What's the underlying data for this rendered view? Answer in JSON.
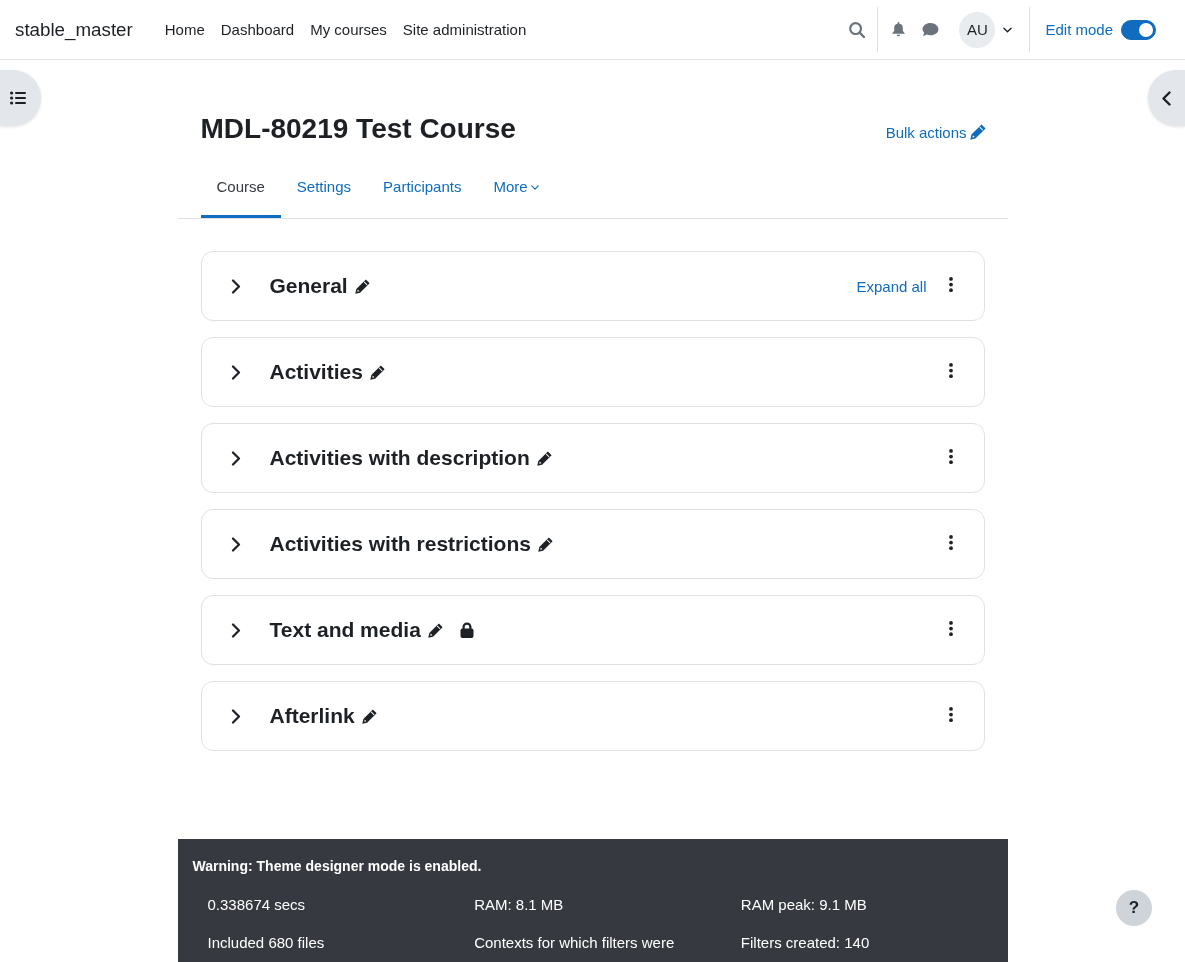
{
  "navbar": {
    "brand": "stable_master",
    "links": [
      {
        "label": "Home",
        "selected": false
      },
      {
        "label": "Dashboard",
        "selected": false
      },
      {
        "label": "My courses",
        "selected": false
      },
      {
        "label": "Site administration",
        "selected": false
      }
    ],
    "user": {
      "initials": "AU"
    },
    "edit_mode": {
      "label": "Edit mode",
      "on": true
    }
  },
  "course": {
    "title": "MDL-80219 Test Course",
    "bulk_actions": "Bulk actions"
  },
  "tabs": [
    {
      "label": "Course",
      "selected": true,
      "kind": "link"
    },
    {
      "label": "Settings",
      "selected": false,
      "kind": "link"
    },
    {
      "label": "Participants",
      "selected": false,
      "kind": "link"
    },
    {
      "label": "More",
      "selected": false,
      "kind": "menu"
    }
  ],
  "sections": [
    {
      "title": "General",
      "expanded": false,
      "locked": false,
      "expand_all": "Expand all"
    },
    {
      "title": "Activities",
      "expanded": false,
      "locked": false
    },
    {
      "title": "Activities with description",
      "expanded": false,
      "locked": false
    },
    {
      "title": "Activities with restrictions",
      "expanded": false,
      "locked": false
    },
    {
      "title": "Text and media",
      "expanded": false,
      "locked": true
    },
    {
      "title": "Afterlink",
      "expanded": false,
      "locked": false
    }
  ],
  "footer": {
    "warning": "Warning: Theme designer mode is enabled.",
    "stats": [
      "0.338674 secs",
      "RAM: 8.1 MB",
      "RAM peak: 9.1 MB",
      "Included 680 files",
      "Contexts for which filters were",
      "Filters created: 140"
    ]
  },
  "help": {
    "label": "?"
  }
}
